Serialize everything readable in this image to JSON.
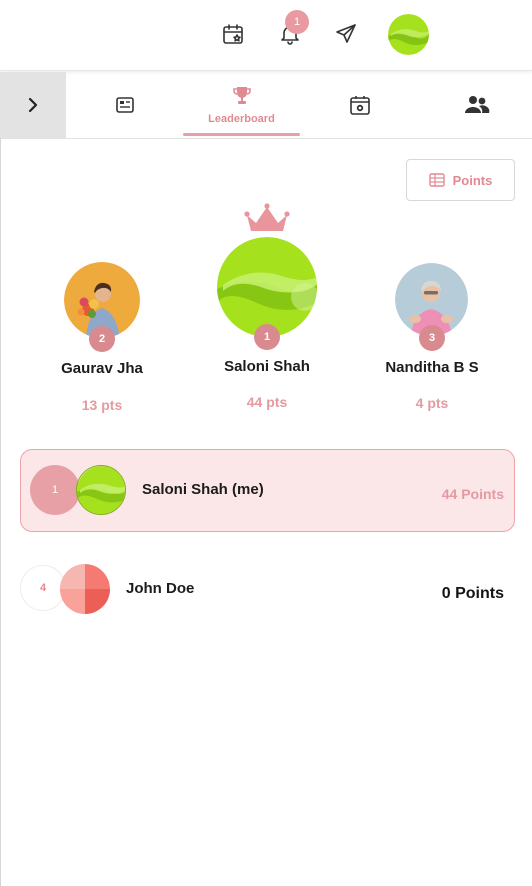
{
  "header": {
    "notification_count": "1",
    "icons": [
      "calendar-star-icon",
      "bell-icon",
      "paper-plane-icon",
      "user-avatar"
    ]
  },
  "tabs": [
    {
      "icon": "news-card-icon",
      "label": ""
    },
    {
      "icon": "trophy-icon",
      "label": "Leaderboard",
      "active": true
    },
    {
      "icon": "calendar-camera-icon",
      "label": ""
    },
    {
      "icon": "people-icon",
      "label": ""
    }
  ],
  "points_button": {
    "label": "Points"
  },
  "podium": {
    "first": {
      "rank": "1",
      "name": "Saloni Shah",
      "points": "44 pts"
    },
    "second": {
      "rank": "2",
      "name": "Gaurav Jha",
      "points": "13 pts"
    },
    "third": {
      "rank": "3",
      "name": "Nanditha B S",
      "points": "4 pts"
    }
  },
  "list": [
    {
      "rank": "1",
      "name": "Saloni Shah (me)",
      "points": "44 Points"
    },
    {
      "rank": "4",
      "name": "John Doe",
      "points": "0 Points"
    }
  ],
  "colors": {
    "accent": "#e28a92",
    "highlight_bg": "#fbe7e8",
    "lime": "#a8e020"
  }
}
